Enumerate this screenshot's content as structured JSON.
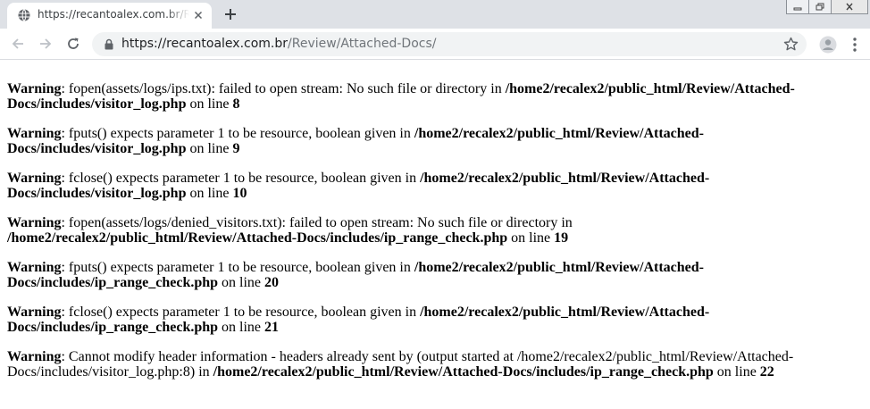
{
  "browser": {
    "tab_title": "https://recantoalex.com.br/Review/Attached-Docs/",
    "url_host": "https://recantoalex.com.br",
    "url_path": "/Review/Attached-Docs/",
    "icons": [
      "globe-icon",
      "close-icon",
      "plus-icon",
      "back-icon",
      "forward-icon",
      "reload-icon",
      "lock-icon",
      "star-icon",
      "avatar-icon",
      "more-vert-icon",
      "minimize-icon",
      "restore-icon",
      "close-window-icon"
    ]
  },
  "warnings": [
    {
      "label": "Warning",
      "message": ": fopen(assets/logs/ips.txt): failed to open stream: No such file or directory in ",
      "file": "/home2/recalex2/public_html/Review/Attached-Docs/includes/visitor_log.php",
      "on_line": " on line ",
      "line": "8"
    },
    {
      "label": "Warning",
      "message": ": fputs() expects parameter 1 to be resource, boolean given in ",
      "file": "/home2/recalex2/public_html/Review/Attached-Docs/includes/visitor_log.php",
      "on_line": " on line ",
      "line": "9"
    },
    {
      "label": "Warning",
      "message": ": fclose() expects parameter 1 to be resource, boolean given in ",
      "file": "/home2/recalex2/public_html/Review/Attached-Docs/includes/visitor_log.php",
      "on_line": " on line ",
      "line": "10"
    },
    {
      "label": "Warning",
      "message": ": fopen(assets/logs/denied_visitors.txt): failed to open stream: No such file or directory in ",
      "file": "/home2/recalex2/public_html/Review/Attached-Docs/includes/ip_range_check.php",
      "on_line": " on line ",
      "line": "19"
    },
    {
      "label": "Warning",
      "message": ": fputs() expects parameter 1 to be resource, boolean given in ",
      "file": "/home2/recalex2/public_html/Review/Attached-Docs/includes/ip_range_check.php",
      "on_line": " on line ",
      "line": "20"
    },
    {
      "label": "Warning",
      "message": ": fclose() expects parameter 1 to be resource, boolean given in ",
      "file": "/home2/recalex2/public_html/Review/Attached-Docs/includes/ip_range_check.php",
      "on_line": " on line ",
      "line": "21"
    },
    {
      "label": "Warning",
      "message": ": Cannot modify header information - headers already sent by (output started at /home2/recalex2/public_html/Review/Attached-Docs/includes/visitor_log.php:8) in ",
      "file": "/home2/recalex2/public_html/Review/Attached-Docs/includes/ip_range_check.php",
      "on_line": " on line ",
      "line": "22"
    }
  ]
}
